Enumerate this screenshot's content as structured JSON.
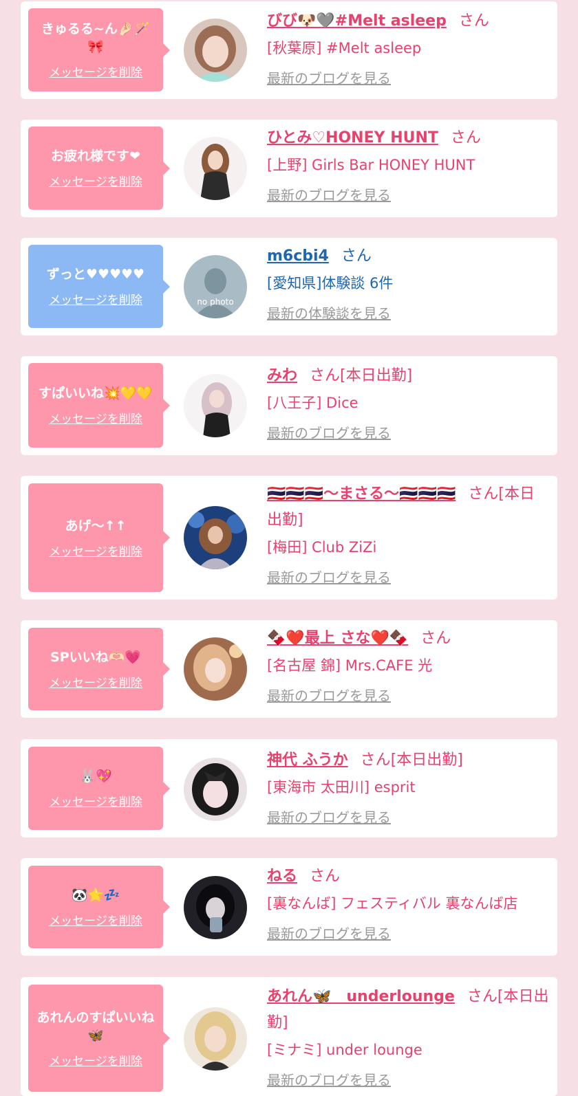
{
  "delete_label": "メッセージを削除",
  "san_label": "さん",
  "colors": {
    "page_bg": "#f7dfe6",
    "pink_bubble": "#ff97ac",
    "blue_bubble": "#8cb8f4",
    "pink_text": "#e8416d",
    "blue_text": "#1d66b3",
    "link_gray": "#9a9a9a"
  },
  "entries": [
    {
      "message": "きゅるる~ん🤌🏻🪄🎀",
      "name": "びび🐶🩶#Melt asleep",
      "status": "",
      "shop": "[秋葉原] #Melt asleep",
      "view_link": "最新のブログを見る",
      "bubble_color": "pink",
      "avatar_icon": "avatar-photo"
    },
    {
      "message": "お疲れ様です❤",
      "name": "ひとみ♡HONEY HUNT",
      "status": "",
      "shop": "[上野] Girls Bar HONEY HUNT",
      "view_link": "最新のブログを見る",
      "bubble_color": "pink",
      "avatar_icon": "avatar-photo"
    },
    {
      "message": "ずっと♥♥♥♥♥",
      "name": "m6cbi4",
      "status": "",
      "shop": "[愛知県]体験談 6件",
      "view_link": "最新の体験談を見る",
      "bubble_color": "blue",
      "avatar_icon": "no-photo-avatar",
      "avatar_text": "no photo"
    },
    {
      "message": "すぱいいね💥💛💛",
      "name": "みわ",
      "status": "[本日出勤]",
      "shop": "[八王子] Dice",
      "view_link": "最新のブログを見る",
      "bubble_color": "pink",
      "avatar_icon": "avatar-photo"
    },
    {
      "message": "あげ〜↑↑",
      "name": "🇹🇭🇹🇭🇹🇭〜まさる〜🇹🇭🇹🇭🇹🇭",
      "status": "[本日出勤]",
      "shop": "[梅田] Club ZiZi",
      "view_link": "最新のブログを見る",
      "bubble_color": "pink",
      "avatar_icon": "avatar-photo"
    },
    {
      "message": "SPいいね🫶🏻💗",
      "name": "🍫❤️最上 さな❤️🍫",
      "status": "",
      "shop": "[名古屋 錦] Mrs.CAFE 光",
      "view_link": "最新のブログを見る",
      "bubble_color": "pink",
      "avatar_icon": "avatar-photo"
    },
    {
      "message": "🐰💖",
      "name": "神代 ふうか",
      "status": "[本日出勤]",
      "shop": "[東海市 太田川] esprit",
      "view_link": "最新のブログを見る",
      "bubble_color": "pink",
      "avatar_icon": "avatar-photo"
    },
    {
      "message": "🐼🌟💤",
      "name": "ねる",
      "status": "",
      "shop": "[裏なんば] フェスティバル 裏なんば店",
      "view_link": "最新のブログを見る",
      "bubble_color": "pink",
      "avatar_icon": "avatar-photo"
    },
    {
      "message": "あれんのすぱいいね🦋",
      "name": "あれん🦋　underlounge",
      "status": "[本日出勤]",
      "shop": "[ミナミ] under lounge",
      "view_link": "最新のブログを見る",
      "bubble_color": "pink",
      "avatar_icon": "avatar-photo"
    }
  ]
}
